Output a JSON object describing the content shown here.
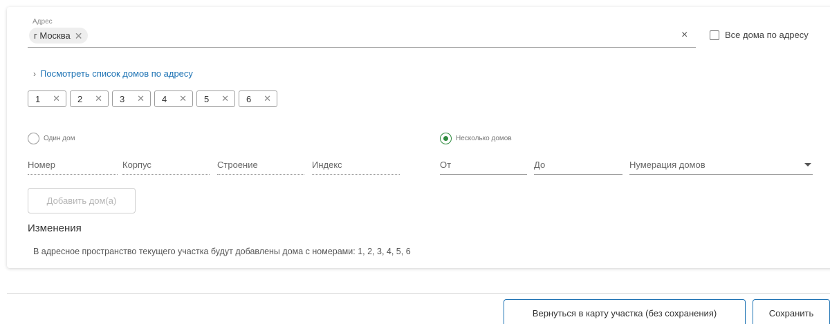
{
  "address": {
    "label": "Адрес",
    "chip": "г Москва",
    "chip_remove": "✕",
    "clear": "×",
    "all_houses_label": "Все дома по адресу"
  },
  "view_houses_link": "Посмотреть список домов по адресу",
  "view_houses_chevron": "›",
  "house_numbers": [
    "1",
    "2",
    "3",
    "4",
    "5",
    "6"
  ],
  "chip_remove": "✕",
  "mode": {
    "one_house_label": "Один дом",
    "many_houses_label": "Несколько домов",
    "selected": "many"
  },
  "fields": {
    "number": "Номер",
    "building_korpus": "Корпус",
    "structure": "Строение",
    "index": "Индекс",
    "from": "От",
    "to": "До",
    "numbering": "Нумерация домов"
  },
  "add_button": "Добавить дом(а)",
  "changes": {
    "title": "Изменения",
    "text": "В адресное пространство текущего участка будут добавлены дома с номерами: 1, 2, 3, 4, 5, 6"
  },
  "footer": {
    "back_button": "Вернуться в карту участка (без сохранения)",
    "save_button": "Сохранить"
  },
  "colors": {
    "link": "#1e73b4",
    "radio_selected": "#2e8b3e",
    "button_border": "#1e73b4"
  }
}
